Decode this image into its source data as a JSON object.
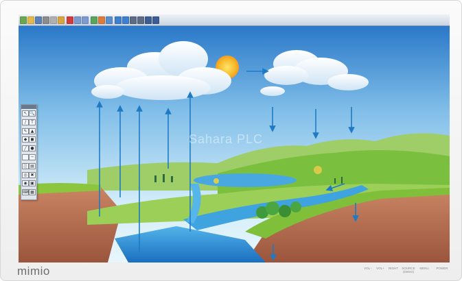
{
  "toolbar": {
    "buttons": [
      {
        "icon": "home-icon",
        "color": "#6aa84f"
      },
      {
        "icon": "open-folder-icon",
        "color": "#e6b84a"
      },
      {
        "icon": "save-icon",
        "color": "#5b7fb8"
      },
      {
        "icon": "print-icon",
        "color": "#8c8c8c"
      },
      {
        "icon": "cut-icon",
        "color": "#b0b0b0"
      },
      {
        "icon": "paste-icon",
        "color": "#d9a441"
      },
      {
        "icon": "delete-icon",
        "color": "#d23b3b"
      },
      {
        "icon": "undo-icon",
        "color": "#7b9bd1"
      },
      {
        "icon": "redo-icon",
        "color": "#7b9bd1"
      },
      {
        "icon": "insert-image-icon",
        "color": "#58a55c"
      },
      {
        "icon": "gallery-icon",
        "color": "#e07b39"
      },
      {
        "icon": "screen-capture-icon",
        "color": "#5a8fcc"
      },
      {
        "icon": "previous-page-icon",
        "color": "#3f7fd0"
      },
      {
        "icon": "next-page-icon",
        "color": "#3f7fd0"
      },
      {
        "icon": "zoom-in-icon",
        "color": "#5d6c82"
      },
      {
        "icon": "zoom-out-icon",
        "color": "#5d6c82"
      },
      {
        "icon": "fullscreen-icon",
        "color": "#3b5d93"
      },
      {
        "icon": "display-icon",
        "color": "#3b5d93"
      }
    ]
  },
  "side_tools": [
    {
      "icon": "select-arrow-icon",
      "glyph": "↖"
    },
    {
      "icon": "zoom-tool-icon",
      "glyph": "🔍"
    },
    {
      "icon": "pen-icon",
      "glyph": "/"
    },
    {
      "icon": "text-tool-icon",
      "glyph": "T"
    },
    {
      "icon": "highlighter-icon",
      "glyph": "✎"
    },
    {
      "icon": "shapes-icon",
      "glyph": "▲"
    },
    {
      "icon": "eraser-icon",
      "glyph": "◆"
    },
    {
      "icon": "fill-icon",
      "glyph": "◼"
    },
    {
      "icon": "line-icon",
      "glyph": "╱"
    },
    {
      "icon": "color-picker-icon",
      "glyph": "●"
    },
    {
      "icon": "color-swatch-icon",
      "glyph": ""
    },
    {
      "icon": "line-width-icon",
      "glyph": "─"
    },
    {
      "icon": "transparency-icon",
      "glyph": "░"
    },
    {
      "icon": "reveal-icon",
      "glyph": "▤"
    },
    {
      "icon": "spotlight-icon",
      "glyph": "◎"
    },
    {
      "icon": "clear-icon",
      "glyph": "✖"
    },
    {
      "icon": "camera-icon",
      "glyph": "◉"
    },
    {
      "icon": "recorder-icon",
      "glyph": "▣"
    },
    {
      "icon": "keyboard-icon",
      "glyph": "⌨"
    },
    {
      "icon": "calculator-icon",
      "glyph": "▦"
    }
  ],
  "watermark": "Sahara PLC",
  "brand": "mimio",
  "hardware_buttons": [
    "VOL−",
    "VOL+",
    "RIGHT",
    "SOURCE",
    "MENU",
    "POWER"
  ],
  "source_sub": "(Detect)",
  "colors": {
    "sky_top": "#1f6fc4",
    "sky_bottom": "#cfe9f7",
    "water": "#2a8fd6",
    "earth": "#b96f50",
    "grass": "#8cc63f",
    "arrow": "#1f7ac4"
  }
}
